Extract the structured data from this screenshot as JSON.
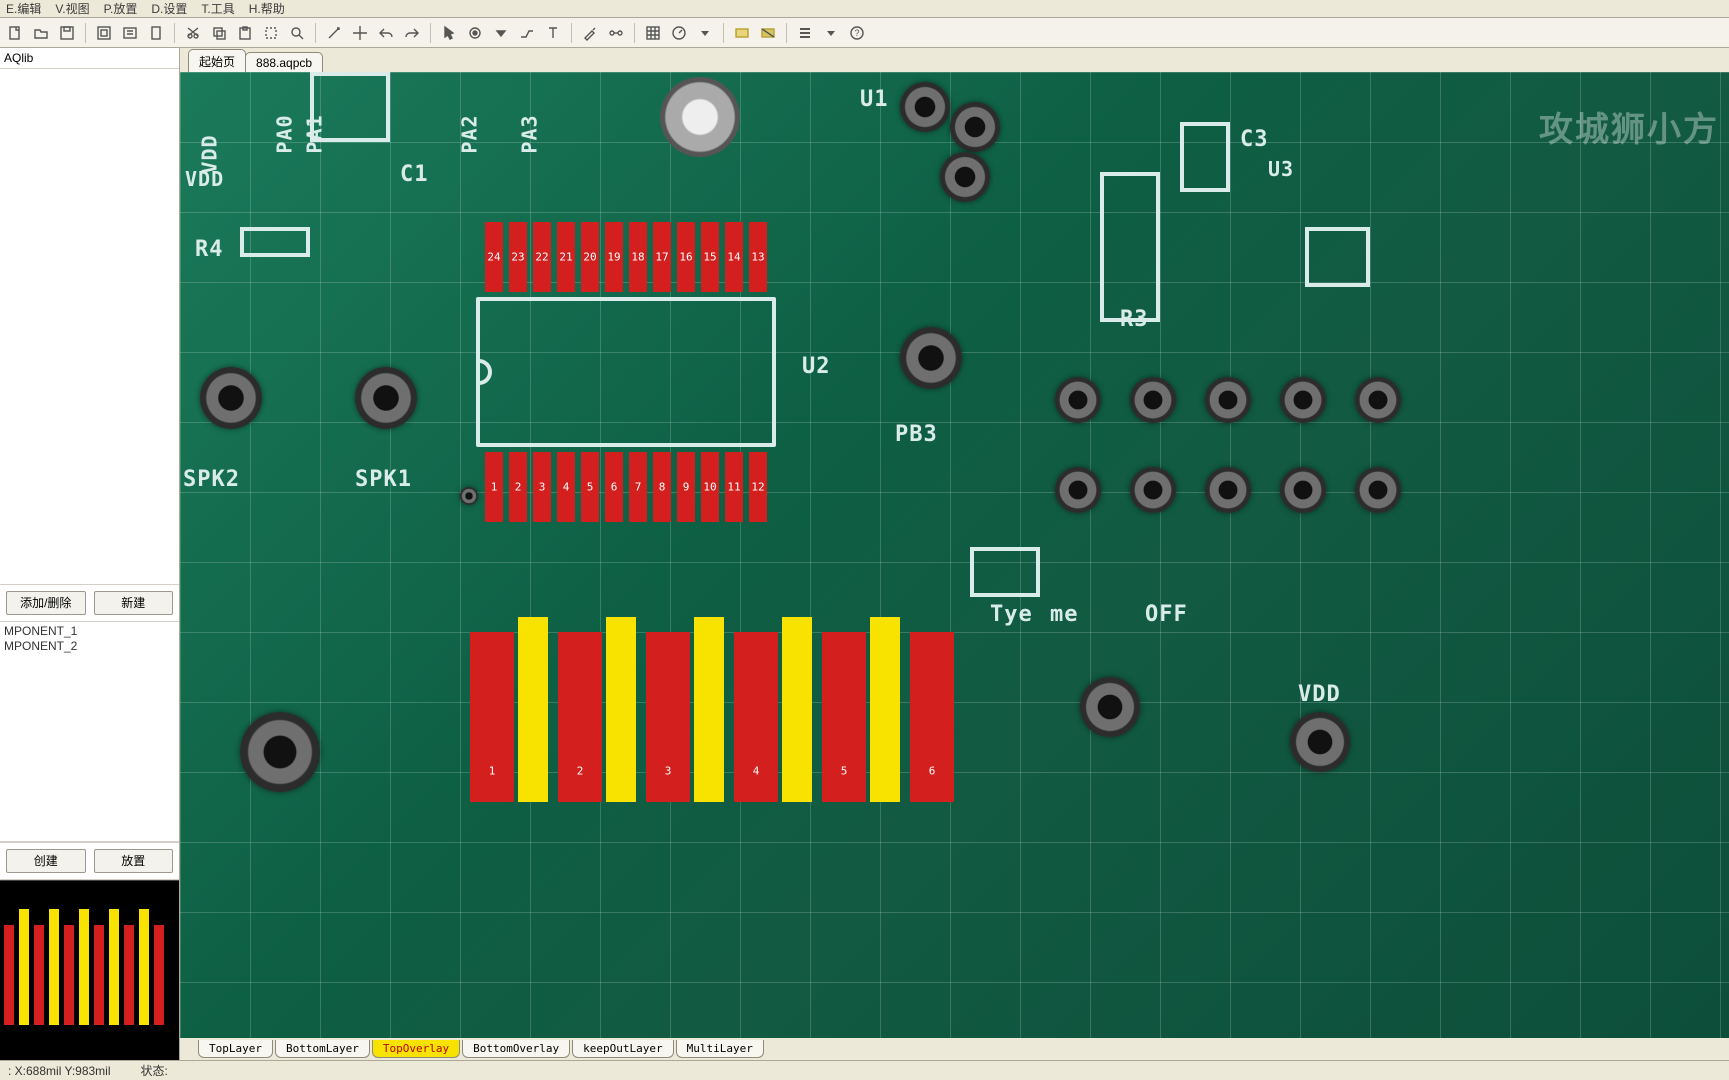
{
  "menu": {
    "edit": "E.编辑",
    "view": "V.视图",
    "place": "P.放置",
    "design": "D.设置",
    "tools": "T.工具",
    "help": "H.帮助"
  },
  "toolbar_icons": [
    "new",
    "open",
    "save",
    "|",
    "fit",
    "zoom-window",
    "zoom-page",
    "|",
    "cut",
    "copy",
    "paste",
    "select-rect",
    "find",
    "|",
    "wand",
    "crosshair",
    "undo",
    "redo",
    "|",
    "pointer",
    "circle",
    "triangle-down",
    "route",
    "text",
    "|",
    "probe",
    "net",
    "|",
    "grid-toggle",
    "measure",
    "dropdown",
    "|",
    "panel1",
    "panel2",
    "|",
    "align",
    "dropdown2",
    "help"
  ],
  "sidebar": {
    "lib": "AQlib",
    "btn_add": "添加/删除",
    "btn_new": "新建",
    "items": [
      "MPONENT_1",
      "MPONENT_2"
    ],
    "btn_create": "创建",
    "btn_place": "放置"
  },
  "tabs": [
    {
      "label": "起始页"
    },
    {
      "label": "888.aqpcb"
    }
  ],
  "silk": {
    "vdd1": "VDD",
    "pa0": "PA0",
    "pa1": "PA1",
    "pa2": "PA2",
    "pa3": "PA3",
    "u1": "U1",
    "c3": "C3",
    "u3": "U3",
    "vdd2": "VDD",
    "c1": "C1",
    "r4": "R4",
    "r3": "R3",
    "u2": "U2",
    "pb3": "PB3",
    "spk2": "SPK2",
    "spk1": "SPK1",
    "tye": "Tye",
    "me": "me",
    "off": "OFF",
    "vdd3": "VDD"
  },
  "u2_top_pins": [
    "24",
    "23",
    "22",
    "21",
    "20",
    "19",
    "18",
    "17",
    "16",
    "15",
    "14",
    "13"
  ],
  "u2_bot_pins": [
    "1",
    "2",
    "3",
    "4",
    "5",
    "6",
    "7",
    "8",
    "9",
    "10",
    "11",
    "12"
  ],
  "conn_pins": [
    "1",
    "2",
    "3",
    "4",
    "5",
    "6"
  ],
  "layers": [
    {
      "name": "TopLayer",
      "active": false
    },
    {
      "name": "BottomLayer",
      "active": false
    },
    {
      "name": "TopOverlay",
      "active": true
    },
    {
      "name": "BottomOverlay",
      "active": false
    },
    {
      "name": "keepOutLayer",
      "active": false
    },
    {
      "name": "MultiLayer",
      "active": false
    }
  ],
  "status": {
    "coord": ": X:688mil   Y:983mil",
    "state": "状态:"
  },
  "watermark": "攻城狮小方"
}
